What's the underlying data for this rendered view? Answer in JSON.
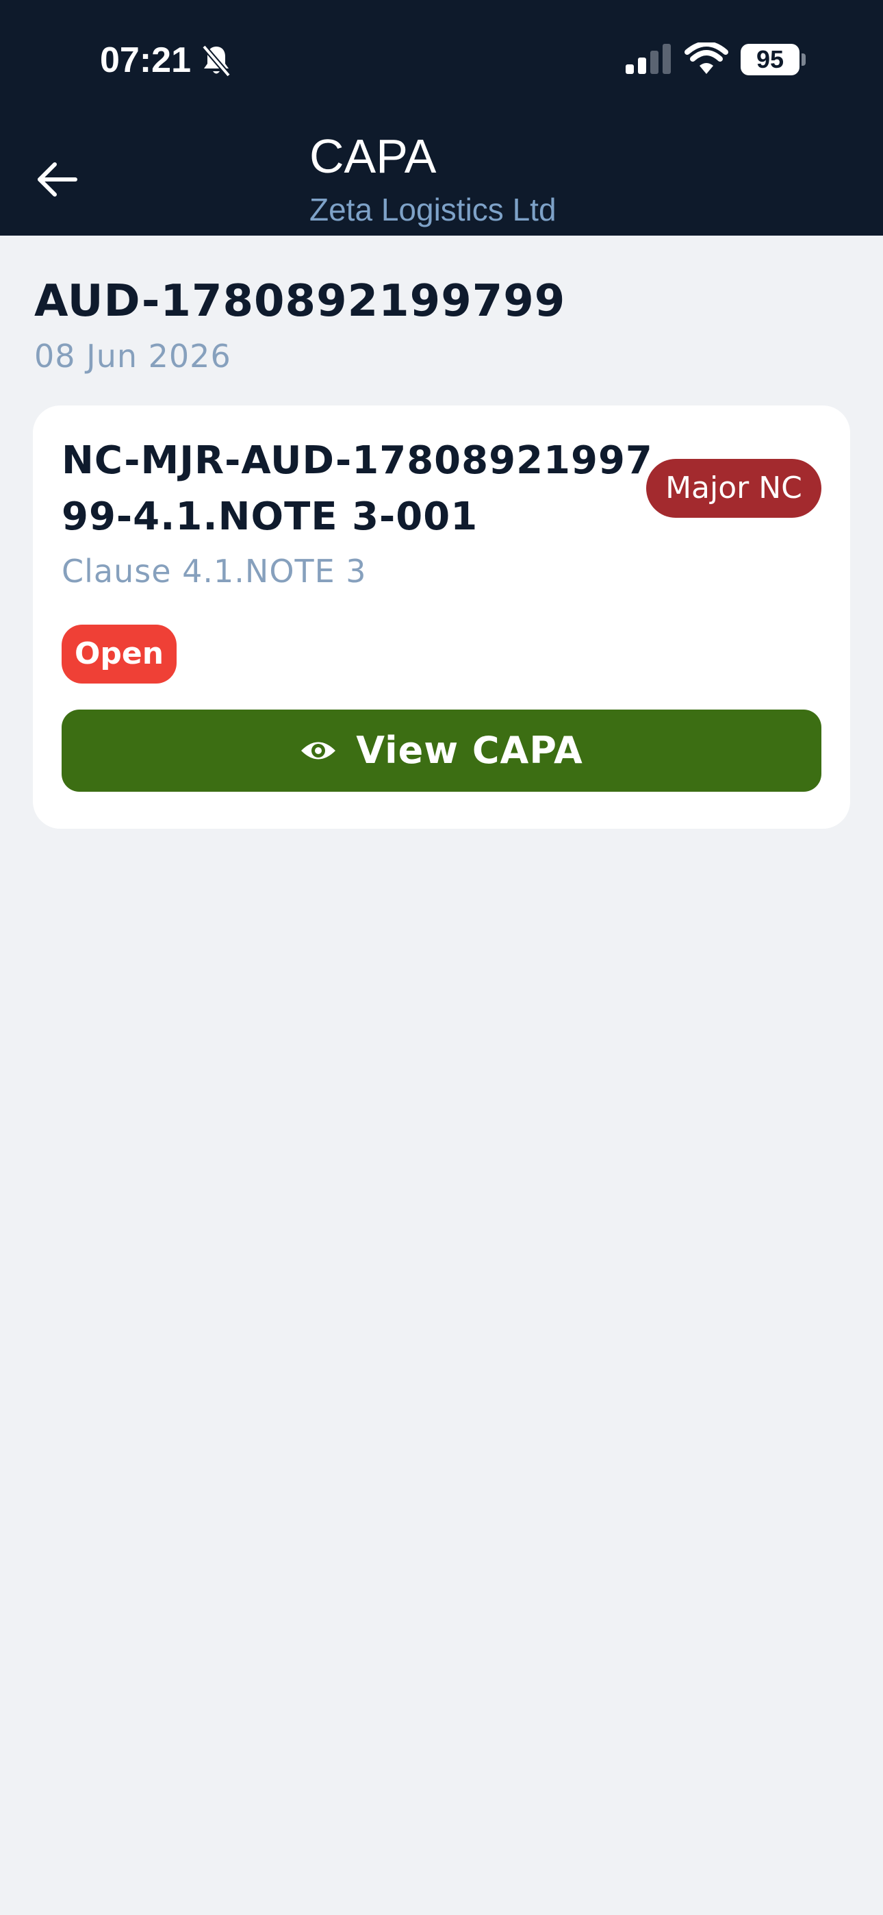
{
  "status_bar": {
    "time": "07:21",
    "battery": "95",
    "icons": [
      "bell-slash-icon",
      "cellular-signal-icon",
      "wifi-icon",
      "battery-icon"
    ]
  },
  "header": {
    "title": "CAPA",
    "subtitle": "Zeta Logistics Ltd",
    "back_icon": "arrow-left-icon"
  },
  "audit": {
    "id": "AUD-1780892199799",
    "date": "08 Jun 2026"
  },
  "card": {
    "nc_id": "NC-MJR-AUD-1780892199799-4.1.NOTE 3-001",
    "severity": "Major NC",
    "clause": "Clause 4.1.NOTE 3",
    "status": "Open",
    "action_label": "View CAPA",
    "action_icon": "eye-icon"
  },
  "colors": {
    "header_bg": "#0e1a2b",
    "severity_bg": "#a32a2e",
    "status_bg": "#ef4036",
    "action_bg": "#3c6e13",
    "muted_text": "#86a0bd"
  }
}
